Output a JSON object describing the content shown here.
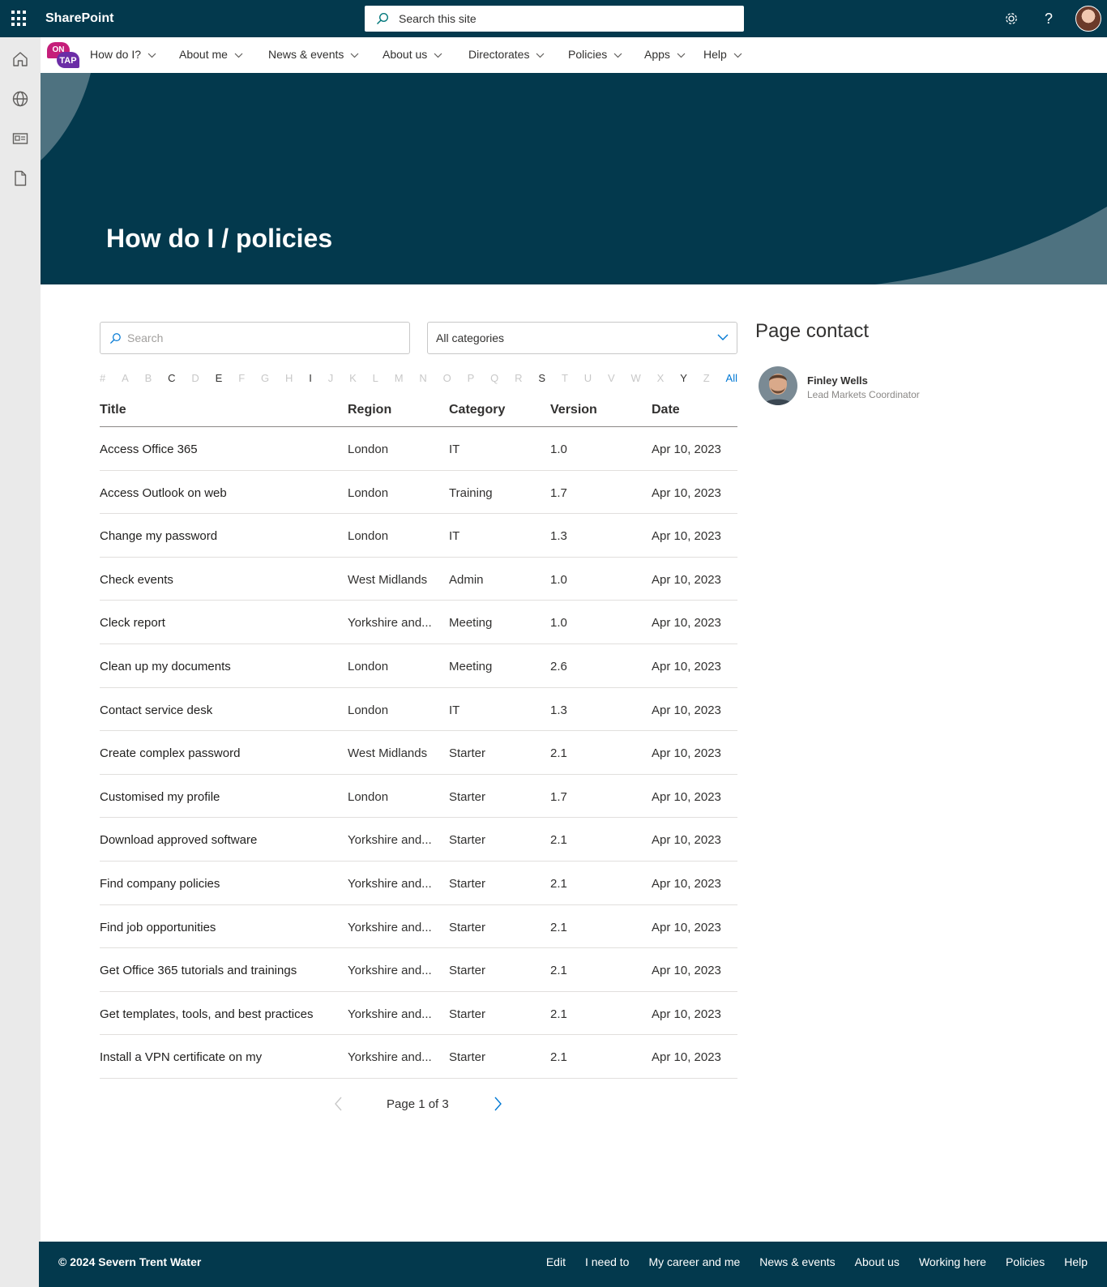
{
  "suite": {
    "brand": "SharePoint",
    "search_placeholder": "Search this site"
  },
  "topnav": {
    "logo_top": "ON",
    "logo_bottom": "TAP",
    "items": [
      {
        "label": "How do I?"
      },
      {
        "label": "About me"
      },
      {
        "label": "News & events"
      },
      {
        "label": "About us"
      },
      {
        "label": "Directorates"
      },
      {
        "label": "Policies"
      },
      {
        "label": "Apps"
      },
      {
        "label": "Help"
      }
    ]
  },
  "hero": {
    "title": "How do I / policies"
  },
  "filters": {
    "search_placeholder": "Search",
    "category_value": "All categories"
  },
  "alphabet": [
    {
      "label": "#",
      "active": false
    },
    {
      "label": "A",
      "active": false
    },
    {
      "label": "B",
      "active": false
    },
    {
      "label": "C",
      "active": true
    },
    {
      "label": "D",
      "active": false
    },
    {
      "label": "E",
      "active": true
    },
    {
      "label": "F",
      "active": false
    },
    {
      "label": "G",
      "active": false
    },
    {
      "label": "H",
      "active": false
    },
    {
      "label": "I",
      "active": true
    },
    {
      "label": "J",
      "active": false
    },
    {
      "label": "K",
      "active": false
    },
    {
      "label": "L",
      "active": false
    },
    {
      "label": "M",
      "active": false
    },
    {
      "label": "N",
      "active": false
    },
    {
      "label": "O",
      "active": false
    },
    {
      "label": "P",
      "active": false
    },
    {
      "label": "Q",
      "active": false
    },
    {
      "label": "R",
      "active": false
    },
    {
      "label": "S",
      "active": true
    },
    {
      "label": "T",
      "active": false
    },
    {
      "label": "U",
      "active": false
    },
    {
      "label": "V",
      "active": false
    },
    {
      "label": "W",
      "active": false
    },
    {
      "label": "X",
      "active": false
    },
    {
      "label": "Y",
      "active": true
    },
    {
      "label": "Z",
      "active": false
    },
    {
      "label": "All",
      "active": true
    }
  ],
  "table": {
    "headers": {
      "title": "Title",
      "region": "Region",
      "category": "Category",
      "version": "Version",
      "date": "Date"
    },
    "rows": [
      {
        "title": "Access Office 365",
        "region": "London",
        "category": "IT",
        "version": "1.0",
        "date": "Apr 10, 2023"
      },
      {
        "title": "Access Outlook on web",
        "region": "London",
        "category": "Training",
        "version": "1.7",
        "date": "Apr 10, 2023"
      },
      {
        "title": "Change my password",
        "region": "London",
        "category": "IT",
        "version": "1.3",
        "date": "Apr 10, 2023"
      },
      {
        "title": "Check events",
        "region": "West Midlands",
        "category": "Admin",
        "version": "1.0",
        "date": "Apr 10, 2023"
      },
      {
        "title": "Cleck report",
        "region": "Yorkshire and...",
        "category": "Meeting",
        "version": "1.0",
        "date": "Apr 10, 2023"
      },
      {
        "title": "Clean up my documents",
        "region": "London",
        "category": "Meeting",
        "version": "2.6",
        "date": "Apr 10, 2023"
      },
      {
        "title": "Contact service desk",
        "region": "London",
        "category": "IT",
        "version": "1.3",
        "date": "Apr 10, 2023"
      },
      {
        "title": "Create complex password",
        "region": "West Midlands",
        "category": "Starter",
        "version": "2.1",
        "date": "Apr 10, 2023"
      },
      {
        "title": "Customised my profile",
        "region": "London",
        "category": "Starter",
        "version": "1.7",
        "date": "Apr 10, 2023"
      },
      {
        "title": "Download approved software",
        "region": "Yorkshire and...",
        "category": "Starter",
        "version": "2.1",
        "date": "Apr 10, 2023"
      },
      {
        "title": "Find company policies",
        "region": "Yorkshire and...",
        "category": "Starter",
        "version": "2.1",
        "date": "Apr 10, 2023"
      },
      {
        "title": "Find job opportunities",
        "region": "Yorkshire and...",
        "category": "Starter",
        "version": "2.1",
        "date": "Apr 10, 2023"
      },
      {
        "title": "Get Office 365 tutorials and trainings",
        "region": "Yorkshire and...",
        "category": "Starter",
        "version": "2.1",
        "date": "Apr 10, 2023"
      },
      {
        "title": "Get templates, tools, and best practices",
        "region": "Yorkshire and...",
        "category": "Starter",
        "version": "2.1",
        "date": "Apr 10, 2023"
      },
      {
        "title": "Install a VPN certificate on my",
        "region": "Yorkshire and...",
        "category": "Starter",
        "version": "2.1",
        "date": "Apr 10, 2023"
      }
    ]
  },
  "pager": {
    "text": "Page 1 of 3"
  },
  "contact": {
    "heading": "Page contact",
    "name": "Finley Wells",
    "role": "Lead Markets Coordinator"
  },
  "footer": {
    "copyright": "© 2024 Severn Trent Water",
    "links": [
      {
        "label": "Edit"
      },
      {
        "label": "I need to"
      },
      {
        "label": "My career and me"
      },
      {
        "label": "News & events"
      },
      {
        "label": "About us"
      },
      {
        "label": "Working here"
      },
      {
        "label": "Policies"
      },
      {
        "label": "Help"
      }
    ]
  },
  "colors": {
    "brand_dark": "#03394d",
    "accent": "#0078d4",
    "hero_curve": "#4e7280"
  }
}
